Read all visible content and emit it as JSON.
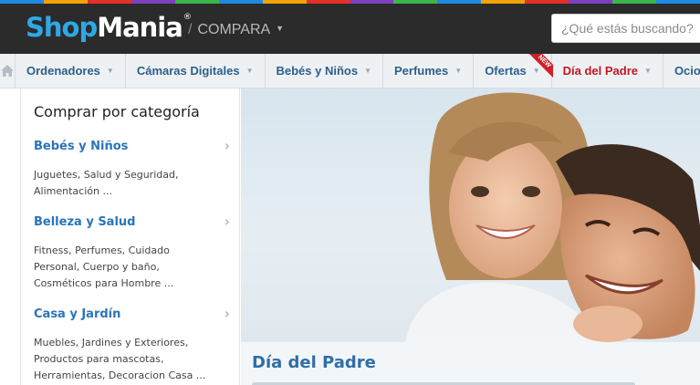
{
  "rainbow_colors": [
    "#1f8ae6",
    "#f0a30a",
    "#e5302a",
    "#7b3fbf",
    "#3bb54a",
    "#1f8ae6",
    "#f0a30a",
    "#e5302a",
    "#7b3fbf",
    "#3bb54a",
    "#1f8ae6",
    "#f0a30a",
    "#e5302a",
    "#7b3fbf",
    "#3bb54a",
    "#1f8ae6"
  ],
  "header": {
    "logo_shop": "Shop",
    "logo_mania": "Mania",
    "logo_reg": "®",
    "compare_slash": "/",
    "compare_label": "COMPARA",
    "search_placeholder": "¿Qué estás buscando?"
  },
  "nav": {
    "home_icon": "home-icon",
    "items": [
      {
        "label": "Ordenadores"
      },
      {
        "label": "Cámaras Digitales"
      },
      {
        "label": "Bebés y Niños"
      },
      {
        "label": "Perfumes"
      },
      {
        "label": "Ofertas",
        "badge": "NEW"
      },
      {
        "label": "Día del Padre"
      },
      {
        "label": "Ocio"
      }
    ]
  },
  "sidebar": {
    "title": "Comprar por categoría",
    "categories": [
      {
        "name": "Bebés y Niños",
        "sub": [
          "Juguetes, Salud y Seguridad,",
          "Alimentación ..."
        ]
      },
      {
        "name": "Belleza y Salud",
        "sub": [
          "Fitness, Perfumes, Cuidado",
          "Personal, Cuerpo y baño,",
          "Cosméticos para Hombre ..."
        ]
      },
      {
        "name": "Casa y Jardín",
        "sub": [
          "Muebles, Jardines y Exteriores,",
          "Productos para mascotas,",
          "Herramientas, Decoracion Casa ..."
        ]
      }
    ]
  },
  "hero": {
    "title": "Día del Padre"
  }
}
